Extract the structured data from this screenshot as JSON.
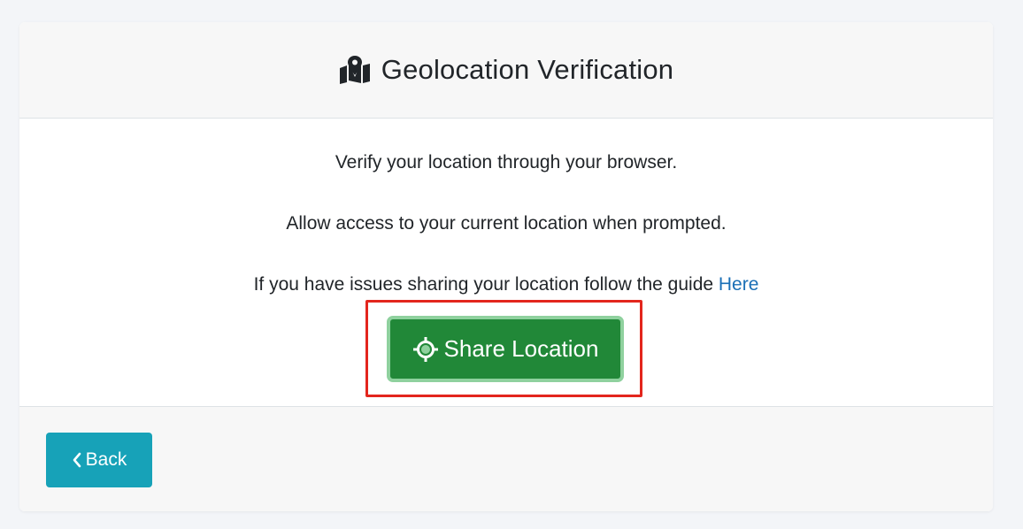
{
  "header": {
    "title": "Geolocation Verification",
    "icon": "map-marked-icon"
  },
  "body": {
    "line1": "Verify your location through your browser.",
    "line2": "Allow access to your current location when prompted.",
    "line3_prefix": "If you have issues sharing your location follow the guide ",
    "line3_link": "Here",
    "share_button": {
      "label": "Share Location",
      "icon": "crosshair-icon",
      "color": "#218838"
    },
    "highlight_color": "#e3261d"
  },
  "footer": {
    "back_button": {
      "label": "Back",
      "icon": "chevron-left-icon",
      "color": "#17a2b8"
    }
  }
}
